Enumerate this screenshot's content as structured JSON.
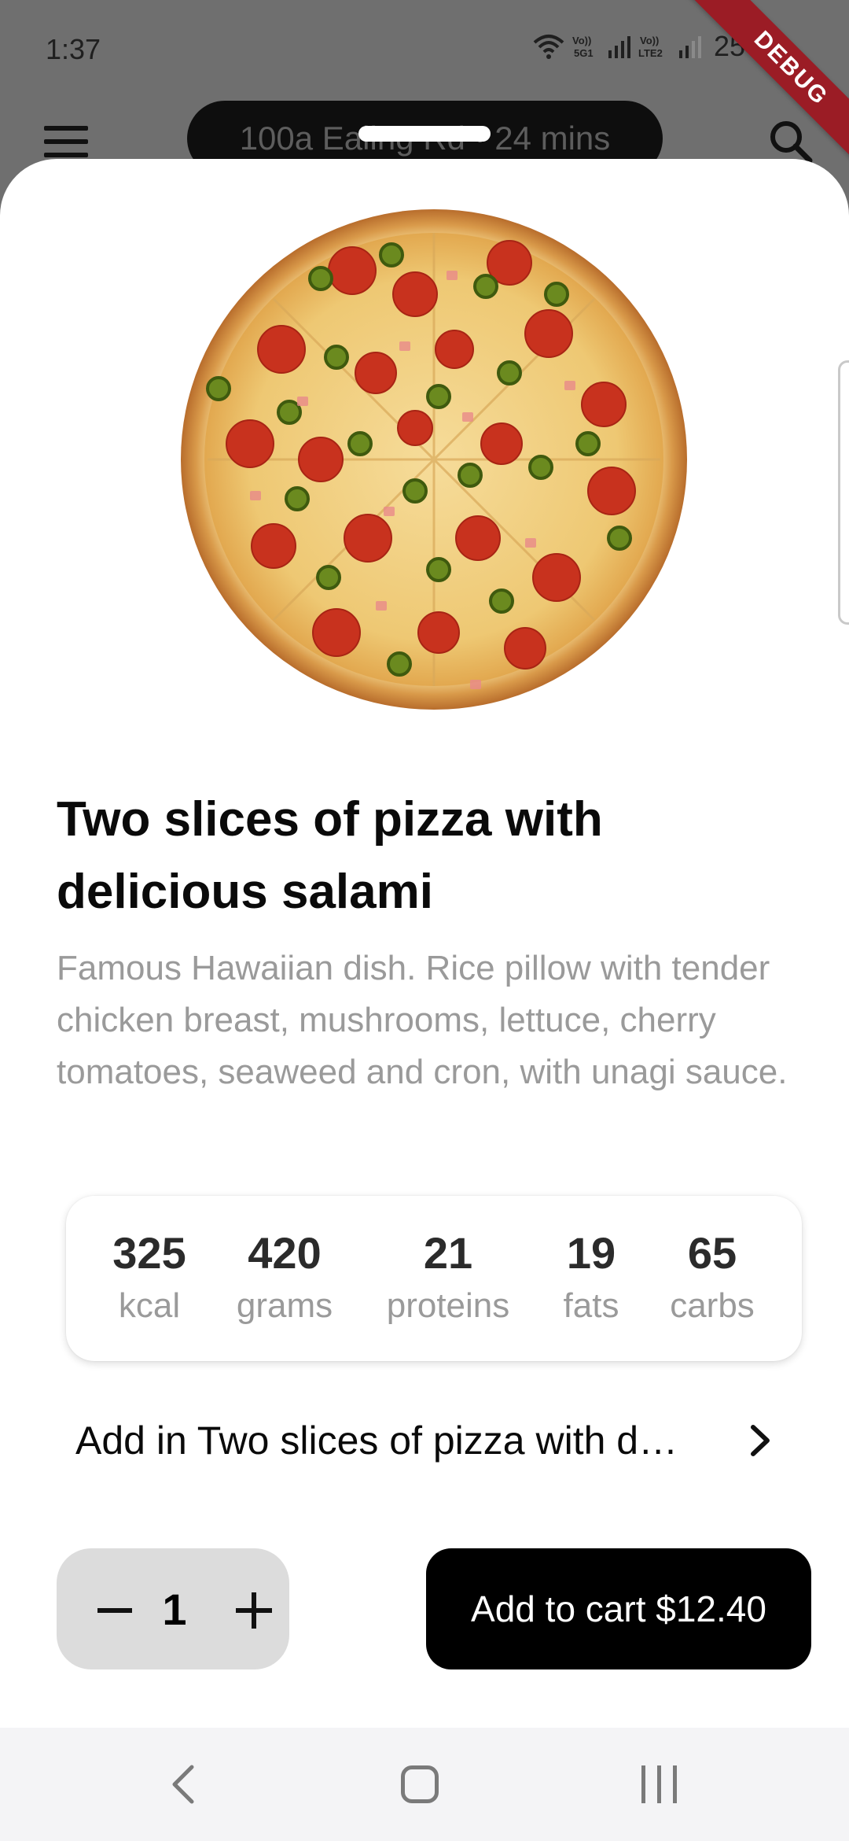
{
  "status_bar": {
    "time": "1:37",
    "battery": "25%",
    "icons": [
      "wifi-icon",
      "volte-5g-icon",
      "signal-icon",
      "volte-lte2-icon",
      "signal-icon-2"
    ]
  },
  "debug_banner": "DEBUG",
  "header": {
    "address": "100a Ealing Rd · 24 mins",
    "menu_icon": "hamburger-menu-icon",
    "search_icon": "search-icon"
  },
  "product": {
    "image": "pizza-image",
    "title": "Two slices of pizza with delicious salami",
    "description": "Famous Hawaiian dish. Rice pillow with tender chicken breast, mushrooms, lettuce, cherry tomatoes, seaweed and cron, with unagi sauce.",
    "nutrition": [
      {
        "value": "325",
        "unit": "kcal"
      },
      {
        "value": "420",
        "unit": "grams"
      },
      {
        "value": "21",
        "unit": "proteins"
      },
      {
        "value": "19",
        "unit": "fats"
      },
      {
        "value": "65",
        "unit": "carbs"
      }
    ],
    "addon_label": "Add in Two slices of pizza with d…",
    "quantity": "1",
    "add_to_cart_label": "Add to cart $12.40"
  },
  "colors": {
    "scrim": "#6f6f6f",
    "debug_ribbon": "#9b1c25",
    "button": "#000000",
    "stepper_bg": "#dcdcdc",
    "muted_text": "#9a9a9a"
  },
  "navigation": [
    "back-icon",
    "home-icon",
    "recents-icon"
  ]
}
